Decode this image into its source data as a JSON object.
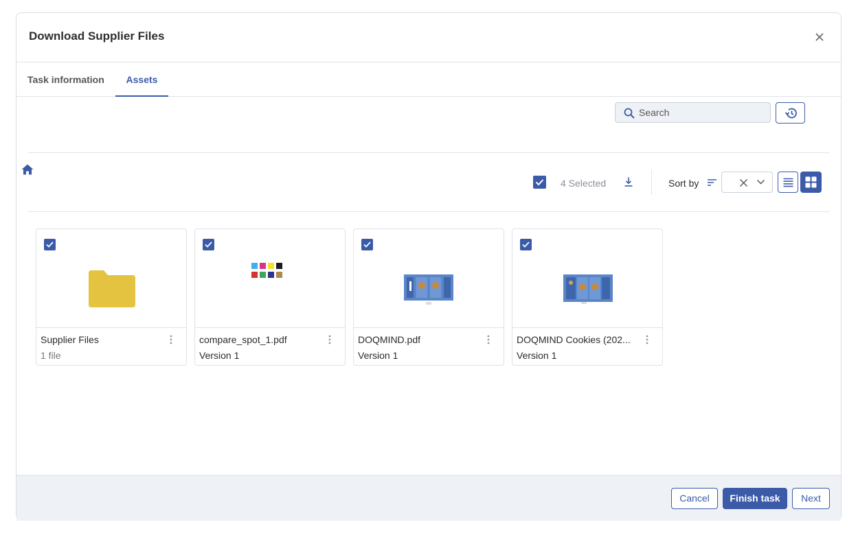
{
  "dialog": {
    "title": "Download Supplier Files"
  },
  "tabs": [
    {
      "label": "Task information",
      "active": false
    },
    {
      "label": "Assets",
      "active": true
    }
  ],
  "search": {
    "placeholder": "Search",
    "value": ""
  },
  "toolbar": {
    "selected_label": "4 Selected",
    "sort_label": "Sort by",
    "sort_value": ""
  },
  "assets": [
    {
      "name": "Supplier Files",
      "sub": "1 file",
      "kind": "folder",
      "checked": true
    },
    {
      "name": "compare_spot_1.pdf",
      "sub": "Version 1",
      "kind": "swatch",
      "checked": true
    },
    {
      "name": "DOQMIND.pdf",
      "sub": "Version 1",
      "kind": "package",
      "checked": true
    },
    {
      "name": "DOQMIND Cookies (202...",
      "sub": "Version 1",
      "kind": "package",
      "checked": true
    }
  ],
  "footer": {
    "cancel_label": "Cancel",
    "finish_label": "Finish task",
    "next_label": "Next"
  },
  "colors": {
    "accent": "#3b5ba9",
    "folder": "#e3c33f",
    "footer_bg": "#eef1f6"
  },
  "icons": [
    "close-icon",
    "search-icon",
    "history-icon",
    "home-icon",
    "download-icon",
    "sort-icon",
    "clear-icon",
    "chevron-down-icon",
    "list-view-icon",
    "grid-view-icon",
    "kebab-menu-icon",
    "folder-icon"
  ]
}
